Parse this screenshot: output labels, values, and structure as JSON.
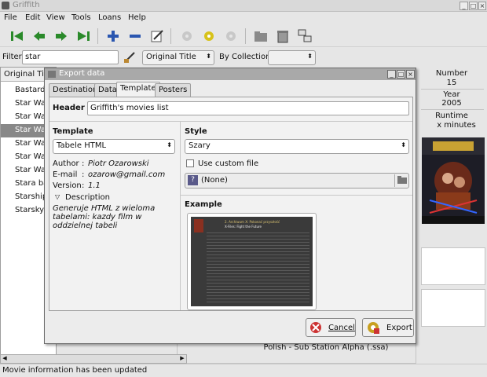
{
  "window": {
    "title": "Griffith"
  },
  "menu": [
    "File",
    "Edit",
    "View",
    "Tools",
    "Loans",
    "Help"
  ],
  "filter": {
    "label": "Filter",
    "value": "star",
    "field_combo": "Original Title",
    "by_collection_label": "By Collection",
    "collection_combo": ""
  },
  "movie_list": {
    "column_header": "Original Title",
    "rows": [
      "Bastard!!",
      "Star Wars",
      "Star Wars",
      "Star Wars",
      "Star Wars",
      "Star Wars",
      "Star Wars",
      "Stara ba",
      "Starship",
      "Starsky &"
    ],
    "selected_index": 3
  },
  "details": {
    "number_label": "Number",
    "number_value": "15",
    "year_label": "Year",
    "year_value": "2005",
    "runtime_label": "Runtime",
    "runtime_value": "x minutes",
    "subtitle_line": "Polish - Sub Station Alpha (.ssa)"
  },
  "status": "Movie information has been updated",
  "dialog": {
    "title": "Export data",
    "tabs": [
      "Destination",
      "Data",
      "Template",
      "Posters"
    ],
    "active_tab": "Template",
    "header_label": "Header",
    "header_value": "Griffith's movies list",
    "template_section": "Template",
    "template_combo": "Tabele HTML",
    "author_label": "Author",
    "author_value": "Piotr Ozarowski",
    "email_label": "E-mail",
    "email_value": "ozarow@gmail.com",
    "version_label": "Version",
    "version_value": "1.1",
    "description_label": "Description",
    "description_text": "Generuje HTML z wieloma tabelami: kazdy film w oddzielnej tabeli",
    "style_section": "Style",
    "style_combo": "Szary",
    "custom_file_label": "Use custom file",
    "custom_file_checked": false,
    "file_chooser": "(None)",
    "example_label": "Example",
    "example_heading": "2. Archiwum X: Pokonać przyszłość",
    "example_subheading": "X-Files: Fight the Future",
    "cancel_label": "Cancel",
    "export_label": "Export"
  }
}
